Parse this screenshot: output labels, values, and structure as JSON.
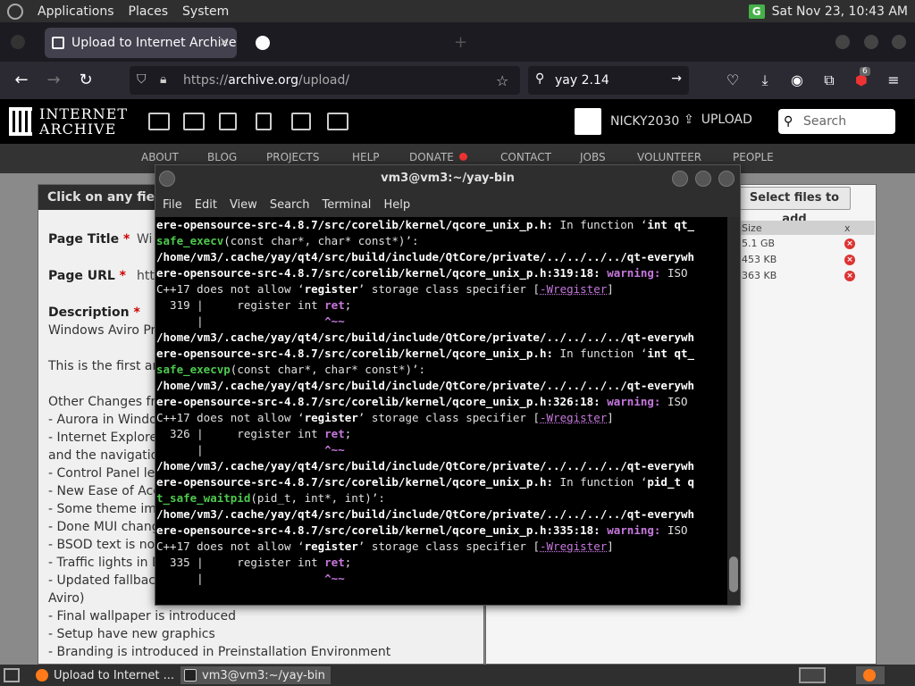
{
  "top_panel": {
    "menus": [
      "Applications",
      "Places",
      "System"
    ],
    "clock": "Sat Nov 23, 10:43 AM",
    "badge": "G"
  },
  "browser": {
    "tabs": [
      {
        "title": "Upload to Internet Archive",
        "active": true
      },
      {
        "title": "",
        "active": false
      }
    ],
    "url_prefix": "https://",
    "url_domain": "archive.org",
    "url_path": "/upload/",
    "search_value": "yay 2.14",
    "ext_badge": "6"
  },
  "ia": {
    "logo_line1": "INTERNET",
    "logo_line2": "ARCHIVE",
    "username": "NICKY2030",
    "upload_label": "UPLOAD",
    "search_placeholder": "Search",
    "nav": [
      "ABOUT",
      "BLOG",
      "PROJECTS",
      "HELP",
      "DONATE",
      "CONTACT",
      "JOBS",
      "VOLUNTEER",
      "PEOPLE"
    ]
  },
  "form": {
    "header": "Click on any field",
    "page_title_label": "Page Title",
    "page_title_value": "Wi",
    "page_url_label": "Page URL",
    "page_url_value": "htt",
    "description_label": "Description",
    "description_lines": [
      "Windows Aviro Pre",
      "",
      "This is the first and",
      "",
      "Other Changes fro",
      "- Aurora in Window",
      "- Internet Explorer",
      "and the navigation",
      "- Control Panel left",
      "- New Ease of Acce",
      "- Some theme impr",
      "- Done MUI change",
      "- BSOD text is now",
      "- Traffic lights in Di",
      "- Updated fallback",
      "Aviro)",
      "- Final wallpaper is introduced",
      "- Setup have new graphics",
      "- Branding is introduced in Preinstallation Environment"
    ]
  },
  "files": {
    "select_label": "Select files to add",
    "size_header": "Size",
    "x_header": "x",
    "rows": [
      "5.1 GB",
      "453 KB",
      "363 KB"
    ]
  },
  "terminal": {
    "title": "vm3@vm3:~/yay-bin",
    "menu": [
      "File",
      "Edit",
      "View",
      "Search",
      "Terminal",
      "Help"
    ],
    "lines": [
      [
        [
          "b",
          "ere-opensource-src-4.8.7/src/corelib/kernel/qcore_unix_p.h:"
        ],
        [
          "n",
          " In function ‘"
        ],
        [
          "b",
          "int qt_"
        ]
      ],
      [
        [
          "g",
          "safe_execv"
        ],
        [
          "n",
          "(const char*, char* const*)’:"
        ]
      ],
      [
        [
          "b",
          "/home/vm3/.cache/yay/qt4/src/build/include/QtCore/private/../../../../qt-everywh"
        ]
      ],
      [
        [
          "b",
          "ere-opensource-src-4.8.7/src/corelib/kernel/qcore_unix_p.h:319:18:"
        ],
        [
          "n",
          " "
        ],
        [
          "m",
          "warning:"
        ],
        [
          "n",
          " ISO"
        ]
      ],
      [
        [
          "n",
          "C++17 does not allow ‘"
        ],
        [
          "b",
          "register"
        ],
        [
          "n",
          "’ storage class specifier ["
        ],
        [
          "mu",
          "-Wregister"
        ],
        [
          "n",
          "]"
        ]
      ],
      [
        [
          "n",
          "  319 |     register int "
        ],
        [
          "m",
          "ret"
        ],
        [
          "n",
          ";"
        ]
      ],
      [
        [
          "n",
          "      |                  "
        ],
        [
          "m",
          "^~~"
        ]
      ],
      [
        [
          "b",
          "/home/vm3/.cache/yay/qt4/src/build/include/QtCore/private/../../../../qt-everywh"
        ]
      ],
      [
        [
          "b",
          "ere-opensource-src-4.8.7/src/corelib/kernel/qcore_unix_p.h:"
        ],
        [
          "n",
          " In function ‘"
        ],
        [
          "b",
          "int qt_"
        ]
      ],
      [
        [
          "g",
          "safe_execvp"
        ],
        [
          "n",
          "(const char*, char* const*)’:"
        ]
      ],
      [
        [
          "b",
          "/home/vm3/.cache/yay/qt4/src/build/include/QtCore/private/../../../../qt-everywh"
        ]
      ],
      [
        [
          "b",
          "ere-opensource-src-4.8.7/src/corelib/kernel/qcore_unix_p.h:326:18:"
        ],
        [
          "n",
          " "
        ],
        [
          "m",
          "warning:"
        ],
        [
          "n",
          " ISO"
        ]
      ],
      [
        [
          "n",
          "C++17 does not allow ‘"
        ],
        [
          "b",
          "register"
        ],
        [
          "n",
          "’ storage class specifier ["
        ],
        [
          "mu",
          "-Wregister"
        ],
        [
          "n",
          "]"
        ]
      ],
      [
        [
          "n",
          "  326 |     register int "
        ],
        [
          "m",
          "ret"
        ],
        [
          "n",
          ";"
        ]
      ],
      [
        [
          "n",
          "      |                  "
        ],
        [
          "m",
          "^~~"
        ]
      ],
      [
        [
          "b",
          "/home/vm3/.cache/yay/qt4/src/build/include/QtCore/private/../../../../qt-everywh"
        ]
      ],
      [
        [
          "b",
          "ere-opensource-src-4.8.7/src/corelib/kernel/qcore_unix_p.h:"
        ],
        [
          "n",
          " In function ‘"
        ],
        [
          "b",
          "pid_t q"
        ]
      ],
      [
        [
          "g",
          "t_safe_waitpid"
        ],
        [
          "n",
          "(pid_t, int*, int)’:"
        ]
      ],
      [
        [
          "b",
          "/home/vm3/.cache/yay/qt4/src/build/include/QtCore/private/../../../../qt-everywh"
        ]
      ],
      [
        [
          "b",
          "ere-opensource-src-4.8.7/src/corelib/kernel/qcore_unix_p.h:335:18:"
        ],
        [
          "n",
          " "
        ],
        [
          "m",
          "warning:"
        ],
        [
          "n",
          " ISO"
        ]
      ],
      [
        [
          "n",
          "C++17 does not allow ‘"
        ],
        [
          "b",
          "register"
        ],
        [
          "n",
          "’ storage class specifier ["
        ],
        [
          "mu",
          "-Wregister"
        ],
        [
          "n",
          "]"
        ]
      ],
      [
        [
          "n",
          "  335 |     register int "
        ],
        [
          "m",
          "ret"
        ],
        [
          "n",
          ";"
        ]
      ],
      [
        [
          "n",
          "      |                  "
        ],
        [
          "m",
          "^~~"
        ]
      ]
    ]
  },
  "taskbar": {
    "tasks": [
      {
        "label": "Upload to Internet ...",
        "active": false
      },
      {
        "label": "vm3@vm3:~/yay-bin",
        "active": true
      }
    ]
  }
}
